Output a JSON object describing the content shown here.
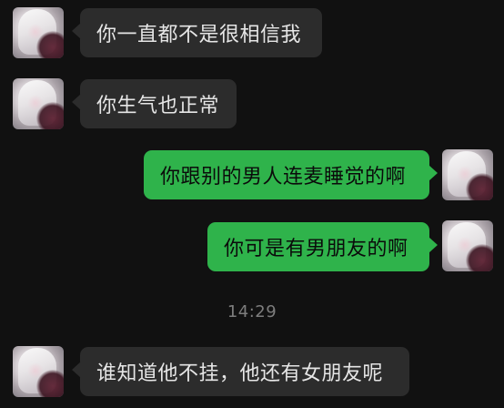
{
  "messages": [
    {
      "side": "incoming",
      "text": "你一直都不是很相信我"
    },
    {
      "side": "incoming",
      "text": "你生气也正常"
    },
    {
      "side": "outgoing",
      "text": "你跟别的男人连麦睡觉的啊"
    },
    {
      "side": "outgoing",
      "text": "你可是有男朋友的啊"
    },
    {
      "side": "incoming",
      "text": "谁知道他不挂，他还有女朋友呢"
    }
  ],
  "timestamp": "14:29",
  "colors": {
    "background": "#111111",
    "incoming_bubble": "#2c2c2c",
    "outgoing_bubble": "#2fb34b",
    "timestamp_text": "#7d7d7d"
  }
}
